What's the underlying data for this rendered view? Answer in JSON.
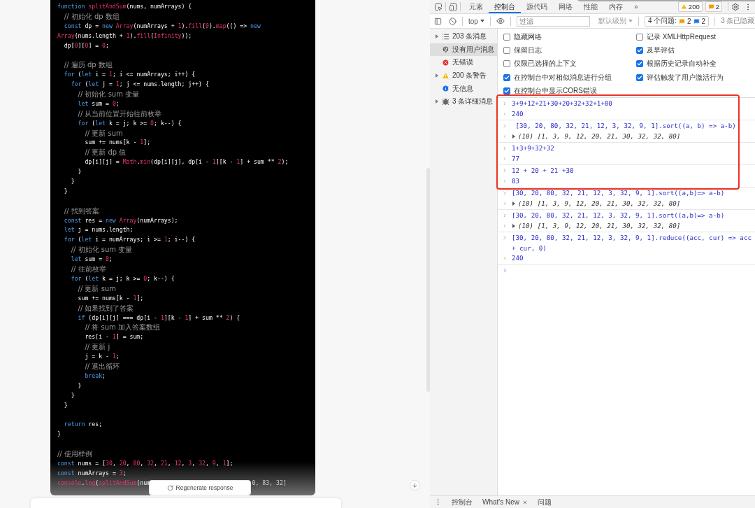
{
  "chat": {
    "code": [
      {
        "kind": "code",
        "tokens": [
          {
            "kind": "kw",
            "text": "function"
          },
          {
            "kind": "fn",
            "text": " splitAndSum"
          },
          {
            "kind": "pl",
            "text": "(nums, numArrays) {"
          }
        ]
      },
      {
        "kind": "comment",
        "text": "  // 初始化 dp 数组"
      },
      {
        "kind": "code",
        "tokens": [
          {
            "kind": "kw",
            "text": "  const"
          },
          {
            "kind": "pl",
            "text": " dp = "
          },
          {
            "kind": "kw",
            "text": "new"
          },
          {
            "kind": "fn",
            "text": " Array"
          },
          {
            "kind": "pl",
            "text": "(numArrays + "
          },
          {
            "kind": "num",
            "text": "1"
          },
          {
            "kind": "pl",
            "text": ")."
          },
          {
            "kind": "fn",
            "text": "fill"
          },
          {
            "kind": "pl",
            "text": "("
          },
          {
            "kind": "num",
            "text": "0"
          },
          {
            "kind": "pl",
            "text": ")."
          },
          {
            "kind": "fn",
            "text": "map"
          },
          {
            "kind": "pl",
            "text": "(() => "
          },
          {
            "kind": "kw",
            "text": "new"
          }
        ]
      },
      {
        "kind": "code",
        "tokens": [
          {
            "kind": "fn",
            "text": "Array"
          },
          {
            "kind": "pl",
            "text": "(nums.length + "
          },
          {
            "kind": "num",
            "text": "1"
          },
          {
            "kind": "pl",
            "text": ")."
          },
          {
            "kind": "fn",
            "text": "fill"
          },
          {
            "kind": "pl",
            "text": "("
          },
          {
            "kind": "fn",
            "text": "Infinity"
          },
          {
            "kind": "pl",
            "text": "));"
          }
        ]
      },
      {
        "kind": "code",
        "tokens": [
          {
            "kind": "pl",
            "text": "  dp["
          },
          {
            "kind": "num",
            "text": "0"
          },
          {
            "kind": "pl",
            "text": "]["
          },
          {
            "kind": "num",
            "text": "0"
          },
          {
            "kind": "pl",
            "text": "] = "
          },
          {
            "kind": "num",
            "text": "0"
          },
          {
            "kind": "pl",
            "text": ";"
          }
        ]
      },
      {
        "kind": "blank"
      },
      {
        "kind": "comment",
        "text": "  // 遍历 dp 数组"
      },
      {
        "kind": "code",
        "tokens": [
          {
            "kind": "kw",
            "text": "  for"
          },
          {
            "kind": "pl",
            "text": " ("
          },
          {
            "kind": "kw",
            "text": "let"
          },
          {
            "kind": "pl",
            "text": " i = "
          },
          {
            "kind": "num",
            "text": "1"
          },
          {
            "kind": "pl",
            "text": "; i <= numArrays; i++) {"
          }
        ]
      },
      {
        "kind": "code",
        "tokens": [
          {
            "kind": "kw",
            "text": "    for"
          },
          {
            "kind": "pl",
            "text": " ("
          },
          {
            "kind": "kw",
            "text": "let"
          },
          {
            "kind": "pl",
            "text": " j = "
          },
          {
            "kind": "num",
            "text": "1"
          },
          {
            "kind": "pl",
            "text": "; j <= nums.length; j++) {"
          }
        ]
      },
      {
        "kind": "comment",
        "text": "      // 初始化 sum 变量"
      },
      {
        "kind": "code",
        "tokens": [
          {
            "kind": "kw",
            "text": "      let"
          },
          {
            "kind": "pl",
            "text": " sum = "
          },
          {
            "kind": "num",
            "text": "0"
          },
          {
            "kind": "pl",
            "text": ";"
          }
        ]
      },
      {
        "kind": "comment",
        "text": "      // 从当前位置开始往前枚举"
      },
      {
        "kind": "code",
        "tokens": [
          {
            "kind": "kw",
            "text": "      for"
          },
          {
            "kind": "pl",
            "text": " ("
          },
          {
            "kind": "kw",
            "text": "let"
          },
          {
            "kind": "pl",
            "text": " k = j; k >= "
          },
          {
            "kind": "num",
            "text": "0"
          },
          {
            "kind": "pl",
            "text": "; k--) {"
          }
        ]
      },
      {
        "kind": "comment",
        "text": "        // 更新 sum"
      },
      {
        "kind": "code",
        "tokens": [
          {
            "kind": "pl",
            "text": "        sum += nums[k - "
          },
          {
            "kind": "num",
            "text": "1"
          },
          {
            "kind": "pl",
            "text": "];"
          }
        ]
      },
      {
        "kind": "comment",
        "text": "        // 更新 dp 值"
      },
      {
        "kind": "code",
        "tokens": [
          {
            "kind": "pl",
            "text": "        dp[i][j] = "
          },
          {
            "kind": "fn",
            "text": "Math"
          },
          {
            "kind": "pl",
            "text": "."
          },
          {
            "kind": "fn",
            "text": "min"
          },
          {
            "kind": "pl",
            "text": "(dp[i][j], dp[i - "
          },
          {
            "kind": "num",
            "text": "1"
          },
          {
            "kind": "pl",
            "text": "][k - "
          },
          {
            "kind": "num",
            "text": "1"
          },
          {
            "kind": "pl",
            "text": "] + sum ** "
          },
          {
            "kind": "num",
            "text": "2"
          },
          {
            "kind": "pl",
            "text": ");"
          }
        ]
      },
      {
        "kind": "code",
        "tokens": [
          {
            "kind": "pl",
            "text": "      }"
          }
        ]
      },
      {
        "kind": "code",
        "tokens": [
          {
            "kind": "pl",
            "text": "    }"
          }
        ]
      },
      {
        "kind": "code",
        "tokens": [
          {
            "kind": "pl",
            "text": "  }"
          }
        ]
      },
      {
        "kind": "blank"
      },
      {
        "kind": "comment",
        "text": "  // 找到答案"
      },
      {
        "kind": "code",
        "tokens": [
          {
            "kind": "kw",
            "text": "  const"
          },
          {
            "kind": "pl",
            "text": " res = "
          },
          {
            "kind": "kw",
            "text": "new"
          },
          {
            "kind": "fn",
            "text": " Array"
          },
          {
            "kind": "pl",
            "text": "(numArrays);"
          }
        ]
      },
      {
        "kind": "code",
        "tokens": [
          {
            "kind": "kw",
            "text": "  let"
          },
          {
            "kind": "pl",
            "text": " j = nums.length;"
          }
        ]
      },
      {
        "kind": "code",
        "tokens": [
          {
            "kind": "kw",
            "text": "  for"
          },
          {
            "kind": "pl",
            "text": " ("
          },
          {
            "kind": "kw",
            "text": "let"
          },
          {
            "kind": "pl",
            "text": " i = numArrays; i >= "
          },
          {
            "kind": "num",
            "text": "1"
          },
          {
            "kind": "pl",
            "text": "; i--) {"
          }
        ]
      },
      {
        "kind": "comment",
        "text": "    // 初始化 sum 变量"
      },
      {
        "kind": "code",
        "tokens": [
          {
            "kind": "kw",
            "text": "    let"
          },
          {
            "kind": "pl",
            "text": " sum = "
          },
          {
            "kind": "num",
            "text": "0"
          },
          {
            "kind": "pl",
            "text": ";"
          }
        ]
      },
      {
        "kind": "comment",
        "text": "    // 往前枚举"
      },
      {
        "kind": "code",
        "tokens": [
          {
            "kind": "kw",
            "text": "    for"
          },
          {
            "kind": "pl",
            "text": " ("
          },
          {
            "kind": "kw",
            "text": "let"
          },
          {
            "kind": "pl",
            "text": " k = j; k >= "
          },
          {
            "kind": "num",
            "text": "0"
          },
          {
            "kind": "pl",
            "text": "; k--) {"
          }
        ]
      },
      {
        "kind": "comment",
        "text": "      // 更新 sum"
      },
      {
        "kind": "code",
        "tokens": [
          {
            "kind": "pl",
            "text": "      sum += nums[k - "
          },
          {
            "kind": "num",
            "text": "1"
          },
          {
            "kind": "pl",
            "text": "];"
          }
        ]
      },
      {
        "kind": "comment",
        "text": "      // 如果找到了答案"
      },
      {
        "kind": "code",
        "tokens": [
          {
            "kind": "kw",
            "text": "      if"
          },
          {
            "kind": "pl",
            "text": " (dp[i][j] === dp[i - "
          },
          {
            "kind": "num",
            "text": "1"
          },
          {
            "kind": "pl",
            "text": "][k - "
          },
          {
            "kind": "num",
            "text": "1"
          },
          {
            "kind": "pl",
            "text": "] + sum ** "
          },
          {
            "kind": "num",
            "text": "2"
          },
          {
            "kind": "pl",
            "text": ") {"
          }
        ]
      },
      {
        "kind": "comment",
        "text": "        // 将 sum 加入答案数组"
      },
      {
        "kind": "code",
        "tokens": [
          {
            "kind": "pl",
            "text": "        res[i - "
          },
          {
            "kind": "num",
            "text": "1"
          },
          {
            "kind": "pl",
            "text": "] = sum;"
          }
        ]
      },
      {
        "kind": "comment",
        "text": "        // 更新 j"
      },
      {
        "kind": "code",
        "tokens": [
          {
            "kind": "pl",
            "text": "        j = k - "
          },
          {
            "kind": "num",
            "text": "1"
          },
          {
            "kind": "pl",
            "text": ";"
          }
        ]
      },
      {
        "kind": "comment",
        "text": "        // 退出循环"
      },
      {
        "kind": "code",
        "tokens": [
          {
            "kind": "kw",
            "text": "        break"
          },
          {
            "kind": "pl",
            "text": ";"
          }
        ]
      },
      {
        "kind": "code",
        "tokens": [
          {
            "kind": "pl",
            "text": "      }"
          }
        ]
      },
      {
        "kind": "code",
        "tokens": [
          {
            "kind": "pl",
            "text": "    }"
          }
        ]
      },
      {
        "kind": "code",
        "tokens": [
          {
            "kind": "pl",
            "text": "  }"
          }
        ]
      },
      {
        "kind": "blank"
      },
      {
        "kind": "code",
        "tokens": [
          {
            "kind": "kw",
            "text": "  return"
          },
          {
            "kind": "pl",
            "text": " res;"
          }
        ]
      },
      {
        "kind": "code",
        "tokens": [
          {
            "kind": "pl",
            "text": "}"
          }
        ]
      },
      {
        "kind": "blank"
      },
      {
        "kind": "comment",
        "text": "// 使用样例"
      },
      {
        "kind": "code",
        "tokens": [
          {
            "kind": "kw",
            "text": "const"
          },
          {
            "kind": "pl",
            "text": " nums = ["
          },
          {
            "kind": "num",
            "text": "30"
          },
          {
            "kind": "pl",
            "text": ", "
          },
          {
            "kind": "num",
            "text": "20"
          },
          {
            "kind": "pl",
            "text": ", "
          },
          {
            "kind": "num",
            "text": "80"
          },
          {
            "kind": "pl",
            "text": ", "
          },
          {
            "kind": "num",
            "text": "32"
          },
          {
            "kind": "pl",
            "text": ", "
          },
          {
            "kind": "num",
            "text": "21"
          },
          {
            "kind": "pl",
            "text": ", "
          },
          {
            "kind": "num",
            "text": "12"
          },
          {
            "kind": "pl",
            "text": ", "
          },
          {
            "kind": "num",
            "text": "3"
          },
          {
            "kind": "pl",
            "text": ", "
          },
          {
            "kind": "num",
            "text": "32"
          },
          {
            "kind": "pl",
            "text": ", "
          },
          {
            "kind": "num",
            "text": "9"
          },
          {
            "kind": "pl",
            "text": ", "
          },
          {
            "kind": "num",
            "text": "1"
          },
          {
            "kind": "pl",
            "text": "];"
          }
        ]
      },
      {
        "kind": "code",
        "tokens": [
          {
            "kind": "kw",
            "text": "const"
          },
          {
            "kind": "pl",
            "text": " numArrays = "
          },
          {
            "kind": "num",
            "text": "3"
          },
          {
            "kind": "pl",
            "text": ";"
          }
        ]
      }
    ],
    "code_tail": {
      "tokens": [
        {
          "kind": "fn",
          "text": "console"
        },
        {
          "kind": "pl",
          "text": "."
        },
        {
          "kind": "fn",
          "text": "log"
        },
        {
          "kind": "pl",
          "text": "("
        },
        {
          "kind": "fn",
          "text": "splitAndSum"
        },
        {
          "kind": "pl",
          "text": "(num"
        }
      ],
      "after_button": "0, 83, 32]"
    },
    "regenerate_button": "Regenerate response"
  },
  "devtools": {
    "tabs": [
      {
        "label": "元素",
        "selected": false
      },
      {
        "label": "控制台",
        "selected": true
      },
      {
        "label": "源代码",
        "selected": false
      },
      {
        "label": "网络",
        "selected": false
      },
      {
        "label": "性能",
        "selected": false
      },
      {
        "label": "内存",
        "selected": false
      }
    ],
    "more_tabs": "»",
    "warning_count": "200",
    "issue_count": "2",
    "toolbar": {
      "context": "top",
      "filter_placeholder": "过滤",
      "level": "默认级别",
      "issues_label": "4 个问题:",
      "issue_counts": [
        "2",
        "2"
      ],
      "hidden": "3 条已隐藏"
    },
    "sidebar": [
      {
        "label": "203 条消息",
        "kind": "list",
        "expandable": true,
        "selected": false
      },
      {
        "label": "没有用户消息",
        "kind": "user",
        "expandable": false,
        "selected": true
      },
      {
        "label": "无错误",
        "kind": "error",
        "expandable": false,
        "selected": false
      },
      {
        "label": "200 条警告",
        "kind": "warning",
        "expandable": true,
        "selected": false
      },
      {
        "label": "无信息",
        "kind": "info",
        "expandable": false,
        "selected": false
      },
      {
        "label": "3 条详细消息",
        "kind": "verbose",
        "expandable": true,
        "selected": false
      }
    ],
    "settings_left": [
      {
        "label": "隐藏网络",
        "checked": false
      },
      {
        "label": "保留日志",
        "checked": false
      },
      {
        "label": "仅限已选择的上下文",
        "checked": false
      },
      {
        "label": "在控制台中对相似消息进行分组",
        "checked": true
      },
      {
        "label": "在控制台中显示CORS错误",
        "checked": true
      }
    ],
    "settings_right": [
      {
        "label": "记录 XMLHttpRequest",
        "checked": false
      },
      {
        "label": "及早评估",
        "checked": true
      },
      {
        "label": "根据历史记录自动补全",
        "checked": true
      },
      {
        "label": "评估触发了用户激活行为",
        "checked": true
      }
    ],
    "console": [
      {
        "input": "3+9+12+21+30+20+32+32+1+80",
        "kind": "value",
        "output": "240"
      },
      {
        "input": " [30, 20, 80, 32, 21, 12, 3, 32, 9, 1].sort((a, b) => a-b)",
        "kind": "array",
        "count": "(10)",
        "output": "[1, 3, 9, 12, 20, 21, 30, 32, 32, 80]"
      },
      {
        "input": "1+3+9+32+32",
        "kind": "value",
        "output": "77"
      },
      {
        "input": "12 + 20 + 21 +30",
        "kind": "value",
        "output": "83"
      },
      {
        "input": "[30, 20, 80, 32, 21, 12, 3, 32, 9, 1].sort((a,b)=> a-b)",
        "kind": "array",
        "count": "(10)",
        "output": "[1, 3, 9, 12, 20, 21, 30, 32, 32, 80]"
      },
      {
        "input": "[30, 20, 80, 32, 21, 12, 3, 32, 9, 1].sort((a,b)=> a-b)",
        "kind": "array",
        "count": "(10)",
        "output": "[1, 3, 9, 12, 20, 21, 30, 32, 32, 80]"
      },
      {
        "input": "[30, 20, 80, 32, 21, 12, 3, 32, 9, 1].reduce((acc, cur) => acc + cur, 0)",
        "kind": "value",
        "output": "240"
      }
    ],
    "drawer_tabs": [
      {
        "label": "控制台",
        "closable": false
      },
      {
        "label": "What's New",
        "closable": true
      },
      {
        "label": "问题",
        "closable": false
      }
    ]
  }
}
